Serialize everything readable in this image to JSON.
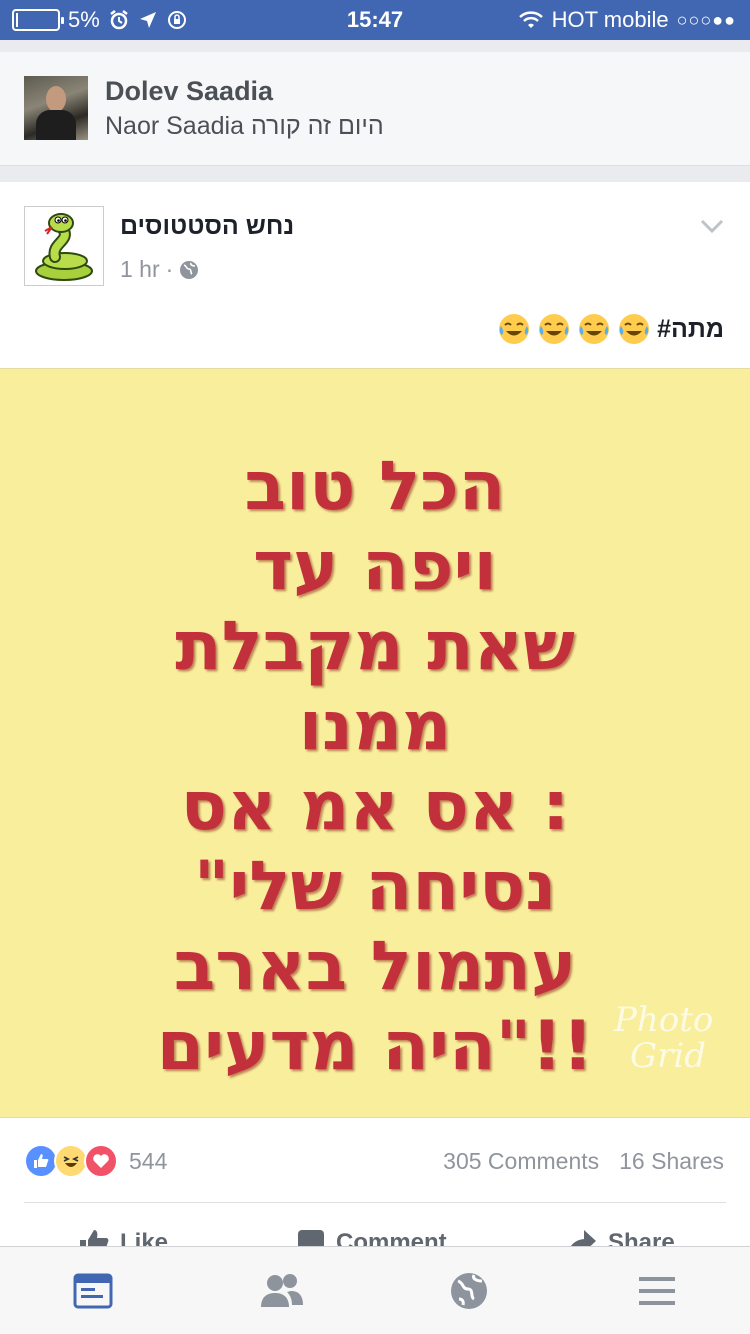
{
  "status_bar": {
    "battery": "5%",
    "battery_level": 0.05,
    "time": "15:47",
    "carrier": "HOT mobile",
    "signal_dots": "○○○●●"
  },
  "share_header": {
    "name": "Dolev Saadia",
    "subtitle": "Naor Saadia היום זה קורה"
  },
  "post": {
    "page_name": "נחש הסטטוסים",
    "time": "1 hr",
    "text": "#מתה",
    "emoji_icon": "tears-of-joy-emoji",
    "image_lines": [
      "הכל טוב",
      "ויפה עד",
      "שאת מקבלת",
      "ממנו",
      "אס אמ אס :",
      "\"נסיחה שלי",
      "עתמול בארב",
      "היה מדעים\"!!"
    ],
    "watermark_line1": "Photo",
    "watermark_line2": "Grid",
    "reactions_count": "544",
    "comments": "305 Comments",
    "shares": "16 Shares",
    "actions": {
      "like": "Like",
      "comment": "Comment",
      "share": "Share"
    }
  },
  "colors": {
    "facebook_blue": "#4267b2",
    "image_background": "#f8ee9c",
    "image_text": "#c2303b"
  },
  "tabs": [
    "news-feed-icon",
    "friends-icon",
    "globe-icon",
    "menu-icon"
  ]
}
